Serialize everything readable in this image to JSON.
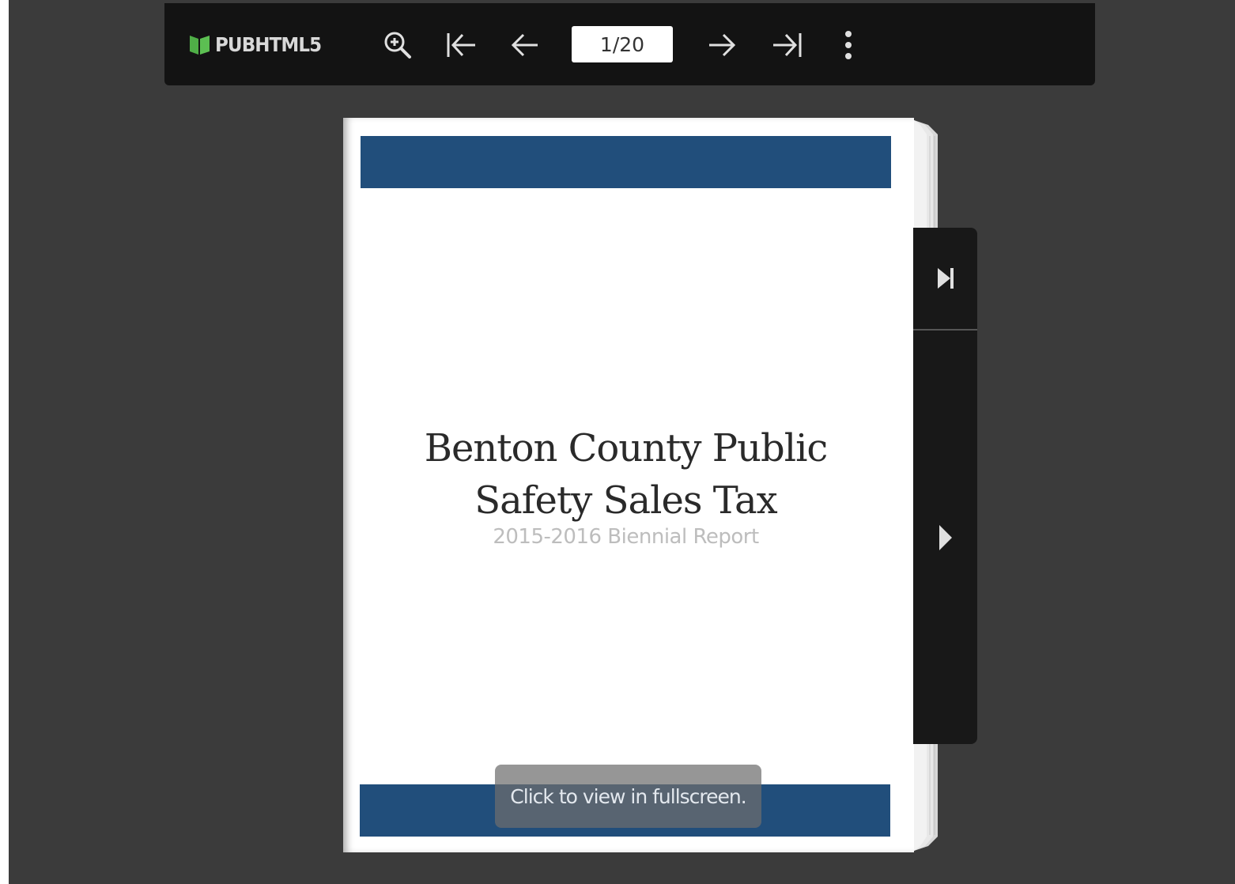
{
  "toolbar": {
    "logo_text": "PUBHTML5",
    "zoom_icon": "zoom-in-icon",
    "first_icon": "first-page-icon",
    "prev_icon": "previous-page-icon",
    "page_indicator": "1/20",
    "next_icon": "next-page-icon",
    "last_icon": "last-page-icon",
    "more_icon": "more-vertical-icon"
  },
  "document": {
    "title_line1": "Benton County Public",
    "title_line2": "Safety Sales Tax",
    "subtitle": "2015-2016 Biennial Report"
  },
  "overlay": {
    "fullscreen_hint": "Click to view in fullscreen."
  },
  "side_panel": {
    "last_icon": "skip-to-end-icon",
    "next_icon": "play-next-icon"
  },
  "colors": {
    "background": "#3b3b3b",
    "toolbar": "#131313",
    "accent_bar": "#214e7b",
    "logo_green": "#5cb85c"
  }
}
